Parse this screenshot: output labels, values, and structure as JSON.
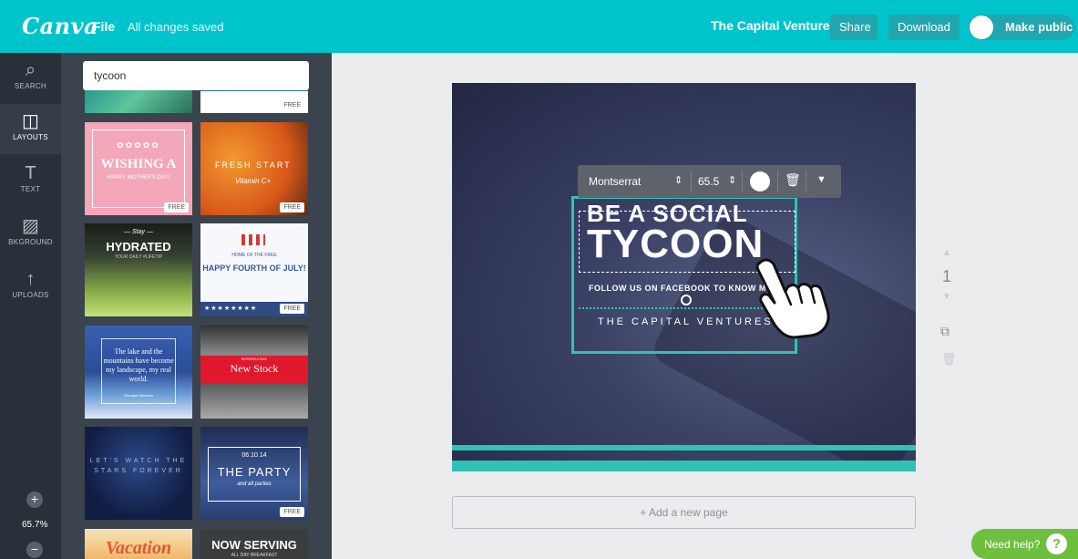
{
  "app": {
    "logo": "Canva",
    "file_menu": "File",
    "save_status": "All changes saved",
    "team_name": "The Capital Ventures",
    "share_label": "Share",
    "download_label": "Download",
    "make_public_label": "Make public",
    "accent_color": "#00c4cc"
  },
  "rail": {
    "items": [
      {
        "label": "SEARCH",
        "icon": "search-icon"
      },
      {
        "label": "LAYOUTS",
        "icon": "layouts-icon"
      },
      {
        "label": "TEXT",
        "icon": "text-icon"
      },
      {
        "label": "BKGROUND",
        "icon": "background-icon"
      },
      {
        "label": "UPLOADS",
        "icon": "upload-icon"
      }
    ],
    "zoom_plus": "+",
    "zoom_level": "65.7%",
    "zoom_minus": "−"
  },
  "panel": {
    "search_value": "tycoon",
    "free_badge": "FREE",
    "templates": [
      {
        "text": ""
      },
      {
        "text": ""
      },
      {
        "text": "WISHING A",
        "sub": "HAPPY MOTHER'S DAY!"
      },
      {
        "text": "FRESH START",
        "sub": "Vitamin C+"
      },
      {
        "text": "HYDRATED",
        "stay": "— Stay —",
        "sub": "YOUR DAILY #LIFETIP"
      },
      {
        "text": "HAPPY FOURTH OF JULY!",
        "sub": "HOME OF THE FREE",
        "stars": "★★★★★★★★"
      },
      {
        "text": "The lake and the mountains have become my landscape, my real world.",
        "sub": "Georges Simenon"
      },
      {
        "text": "New Stock",
        "sub": "INTRODUCING"
      },
      {
        "text": "LET'S WATCH THE STARS FOREVER"
      },
      {
        "text": "THE PARTY",
        "date": "06.10.14",
        "sub": "and all parties"
      },
      {
        "text": "Vacation"
      },
      {
        "text": "NOW SERVING",
        "sub": "ALL DAY BREAKFAST"
      }
    ]
  },
  "canvas": {
    "title_line1": "BE A SOCIAL",
    "title_line2": "TYCOON",
    "follow_text": "FOLLOW US ON FACEBOOK TO KNOW MO",
    "company": "THE CAPITAL VENTURES"
  },
  "text_toolbar": {
    "font": "Montserrat",
    "font_size": "65.5",
    "color": "#ffffff"
  },
  "page_controls": {
    "page_number": "1"
  },
  "add_page_label": "+ Add a new page",
  "help": {
    "label": "Need help?",
    "icon_glyph": "?"
  }
}
